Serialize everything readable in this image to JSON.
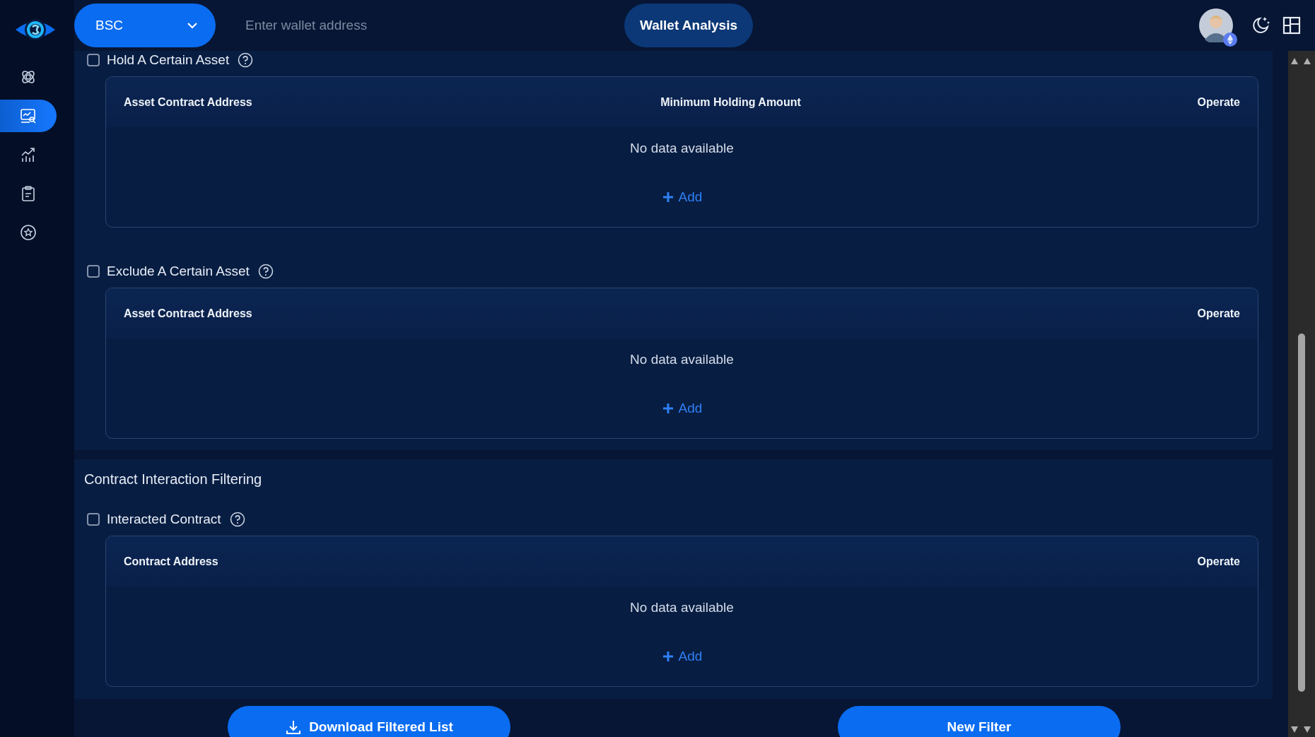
{
  "sidebar": {
    "items": [
      {
        "selected": false
      },
      {
        "selected": true
      },
      {
        "selected": false
      },
      {
        "selected": false
      },
      {
        "selected": false
      }
    ]
  },
  "header": {
    "chain_select": {
      "value": "BSC"
    },
    "search": {
      "placeholder": "Enter wallet address"
    },
    "analyze_button": "Wallet Analysis"
  },
  "sections": [
    {
      "filters": [
        {
          "label": "Hold A Certain Asset",
          "checked": false,
          "table": {
            "columns": [
              "Asset Contract Address",
              "Minimum Holding Amount",
              "Operate"
            ],
            "empty_text": "No data available",
            "add_label": "Add"
          }
        },
        {
          "label": "Exclude A Certain Asset",
          "checked": false,
          "table": {
            "columns": [
              "Asset Contract Address",
              "Operate"
            ],
            "empty_text": "No data available",
            "add_label": "Add"
          }
        }
      ]
    },
    {
      "title": "Contract Interaction Filtering",
      "filters": [
        {
          "label": "Interacted Contract",
          "checked": false,
          "table": {
            "columns": [
              "Contract Address",
              "Operate"
            ],
            "empty_text": "No data available",
            "add_label": "Add"
          }
        }
      ]
    }
  ],
  "footer": {
    "download_button": "Download Filtered List",
    "new_filter_button": "New Filter"
  }
}
